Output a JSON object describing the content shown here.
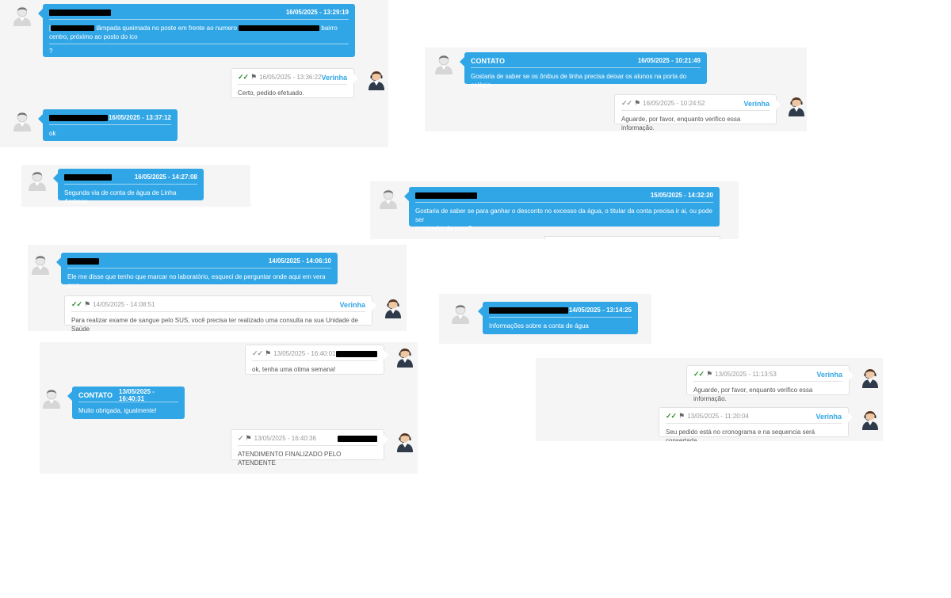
{
  "labels": {
    "contato": "CONTATO",
    "agent": "Verinha",
    "ticks": "✓✓",
    "tick_single": "✓",
    "flag": "⚑"
  },
  "icons": {
    "customer_avatar": "customer-avatar-icon",
    "agent_avatar": "agent-headset-avatar-icon",
    "flag": "flag-icon",
    "check": "double-check-icon"
  },
  "colors": {
    "bubble_incoming": "#31a6e6",
    "agent_name": "#31a6e6",
    "read_ticks": "#2e8b2e",
    "panel_bg": "#f5f5f5"
  },
  "screens": {
    "s1": {
      "m1": {
        "time": "16/05/2025 - 13:29:19",
        "text_a": "lâmpada queimada no poste em frente ao numero",
        "text_b": "bairro",
        "text_c": "centro, próximo ao posto do ico",
        "text_d": "?"
      },
      "m2": {
        "time": "16/05/2025 - 13:36:22",
        "text": "Certo, pedido efetuado."
      },
      "m3": {
        "time": "16/05/2025 - 13:37:12",
        "text": "ok"
      }
    },
    "s2": {
      "m1": {
        "time": "16/05/2025 - 10:21:49",
        "text": "Gostaria de saber se os ônibus de linha precisa deixar os alunos na porta do colégio"
      },
      "m2": {
        "time": "16/05/2025 - 10:24:52",
        "text": "Aguarde, por favor, enquanto verifico essa informação."
      }
    },
    "s3": {
      "m1": {
        "time": "16/05/2025 - 14:27:08",
        "text": "Segunda via de conta de água de Linha Andreas"
      }
    },
    "s4": {
      "m1": {
        "time": "15/05/2025 - 14:32:20",
        "text_a": "Gostaria de saber se para ganhar o desconto no excesso da água, o titular da conta precisa ir ai, ou pode ser",
        "text_b": "o morador da casa?"
      }
    },
    "s5": {
      "m1": {
        "time": "14/05/2025 - 14:06:10",
        "text": "Ele me disse que tenho que marcar no laboratório, esqueci de perguntar onde aqui em vera cruz."
      },
      "m2": {
        "time": "14/05/2025 - 14:08:51",
        "text": "Para realizar exame de sangue pelo SUS, você precisa ter realizado uma consulta na sua Unidade de Saúde"
      }
    },
    "s6": {
      "m1": {
        "time": "14/05/2025 - 13:14:25",
        "text": "Informações sobre a conta de água"
      }
    },
    "s7": {
      "m1": {
        "time": "13/05/2025 - 16:40:01",
        "text": "ok, tenha uma otima semana!"
      },
      "m2": {
        "time": "13/05/2025 - 16:40:31",
        "text": "Muito obrigada, igualmente!"
      },
      "m3": {
        "time": "13/05/2025 - 16:40:36",
        "text": "ATENDIMENTO FINALIZADO PELO ATENDENTE"
      }
    },
    "s8": {
      "m1": {
        "time": "13/05/2025 - 11:13:53",
        "text": "Aguarde, por favor, enquanto verifico essa informação."
      },
      "m2": {
        "time": "13/05/2025 - 11:20:04",
        "text": "Seu pedido está no cronograma e na sequencia será consertada."
      }
    }
  }
}
